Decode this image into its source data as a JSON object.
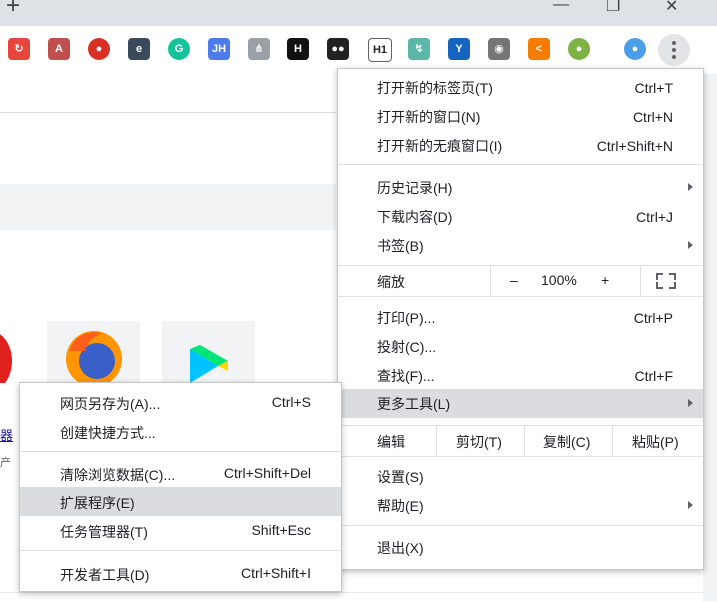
{
  "titlebar": {
    "new_tab_glyph": "+",
    "minimize_glyph": "—",
    "maximize_glyph": "❐",
    "close_glyph": "✕"
  },
  "toolbar": {
    "extensions": [
      {
        "icon": "lastpass-icon",
        "glyph": "↻",
        "color": "#e8453c"
      },
      {
        "icon": "pdf-icon",
        "glyph": "A",
        "color": "#c0504d"
      },
      {
        "icon": "record-icon",
        "glyph": "●",
        "color": "#d93025"
      },
      {
        "icon": "ublock-icon",
        "glyph": "e",
        "color": "#3b4a5a"
      },
      {
        "icon": "grammarly-icon",
        "glyph": "G",
        "color": "#15c39a"
      },
      {
        "icon": "jh-icon",
        "glyph": "JH",
        "color": "#4b7bec"
      },
      {
        "icon": "sitemap-icon",
        "glyph": "⋔",
        "color": "#9aa0a6"
      },
      {
        "icon": "hs-icon",
        "glyph": "H",
        "color": "#111111"
      },
      {
        "icon": "tampermonkey-icon",
        "glyph": "●●",
        "color": "#222222"
      },
      {
        "icon": "h1-icon",
        "glyph": "H1",
        "color": "#ffffff"
      },
      {
        "icon": "vpn-icon",
        "glyph": "↯",
        "color": "#5bb7a8"
      },
      {
        "icon": "yoast-icon",
        "glyph": "Y",
        "color": "#1565c0"
      },
      {
        "icon": "camera-icon",
        "glyph": "◉",
        "color": "#757575"
      },
      {
        "icon": "share-icon",
        "glyph": "<",
        "color": "#f57c00"
      },
      {
        "icon": "status-icon",
        "glyph": "●",
        "color": "#7cb342"
      },
      {
        "icon": "profile-icon",
        "glyph": "●",
        "color": "#4a9fe8"
      }
    ]
  },
  "menu": {
    "new_tab": {
      "label": "打开新的标签页(T)",
      "shortcut": "Ctrl+T"
    },
    "new_window": {
      "label": "打开新的窗口(N)",
      "shortcut": "Ctrl+N"
    },
    "new_incognito": {
      "label": "打开新的无痕窗口(I)",
      "shortcut": "Ctrl+Shift+N"
    },
    "history": {
      "label": "历史记录(H)"
    },
    "downloads": {
      "label": "下载内容(D)",
      "shortcut": "Ctrl+J"
    },
    "bookmarks": {
      "label": "书签(B)"
    },
    "zoom": {
      "label": "缩放",
      "minus": "–",
      "value": "100%",
      "plus": "+"
    },
    "print": {
      "label": "打印(P)...",
      "shortcut": "Ctrl+P"
    },
    "cast": {
      "label": "投射(C)..."
    },
    "find": {
      "label": "查找(F)...",
      "shortcut": "Ctrl+F"
    },
    "more_tools": {
      "label": "更多工具(L)"
    },
    "edit": {
      "label": "编辑",
      "cut": "剪切(T)",
      "copy": "复制(C)",
      "paste": "粘贴(P)"
    },
    "settings": {
      "label": "设置(S)"
    },
    "help": {
      "label": "帮助(E)"
    },
    "exit": {
      "label": "退出(X)"
    }
  },
  "submenu": {
    "save_page": {
      "label": "网页另存为(A)...",
      "shortcut": "Ctrl+S"
    },
    "create_shortcut": {
      "label": "创建快捷方式..."
    },
    "clear_data": {
      "label": "清除浏览数据(C)...",
      "shortcut": "Ctrl+Shift+Del"
    },
    "extensions": {
      "label": "扩展程序(E)"
    },
    "task_manager": {
      "label": "任务管理器(T)",
      "shortcut": "Shift+Esc"
    },
    "dev_tools": {
      "label": "开发者工具(D)",
      "shortcut": "Ctrl+Shift+I"
    }
  },
  "page": {
    "partial_link": "器",
    "partial_text": "产"
  }
}
